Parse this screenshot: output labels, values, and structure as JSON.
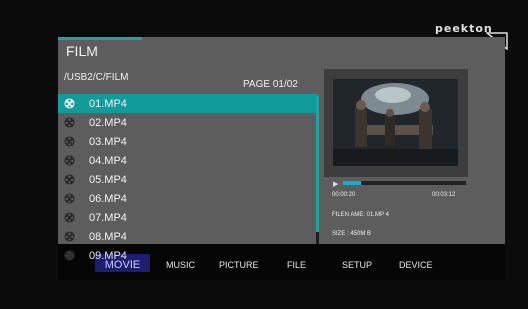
{
  "branding": {
    "logo": "peekton"
  },
  "browser": {
    "title": "FILM",
    "path": "/USB2/C/FILM",
    "page": "PAGE 01/02",
    "files": [
      {
        "name": "01.MP4",
        "selected": true
      },
      {
        "name": "02.MP4",
        "selected": false
      },
      {
        "name": "03.MP4",
        "selected": false
      },
      {
        "name": "04.MP4",
        "selected": false
      },
      {
        "name": "05.MP4",
        "selected": false
      },
      {
        "name": "06.MP4",
        "selected": false
      },
      {
        "name": "07.MP4",
        "selected": false
      },
      {
        "name": "08.MP4",
        "selected": false
      },
      {
        "name": "09.MP4",
        "selected": false
      }
    ]
  },
  "preview": {
    "current_time": "00:00:20",
    "total_time": "00:03:12",
    "progress_fraction": 0.15,
    "filename": "FILEN AME: 01.MP 4",
    "size": "SIZE : 450M B"
  },
  "tabs": [
    {
      "label": "MOVIE",
      "active": true
    },
    {
      "label": "MUSIC",
      "active": false
    },
    {
      "label": "PICTURE",
      "active": false
    },
    {
      "label": "FILE",
      "active": false
    },
    {
      "label": "SETUP",
      "active": false
    },
    {
      "label": "DEVICE",
      "active": false
    }
  ],
  "colors": {
    "accent": "#119b9b",
    "panel": "#5d5d5d",
    "active_tab": "#1e1e70",
    "progress": "#1aa8d0"
  }
}
